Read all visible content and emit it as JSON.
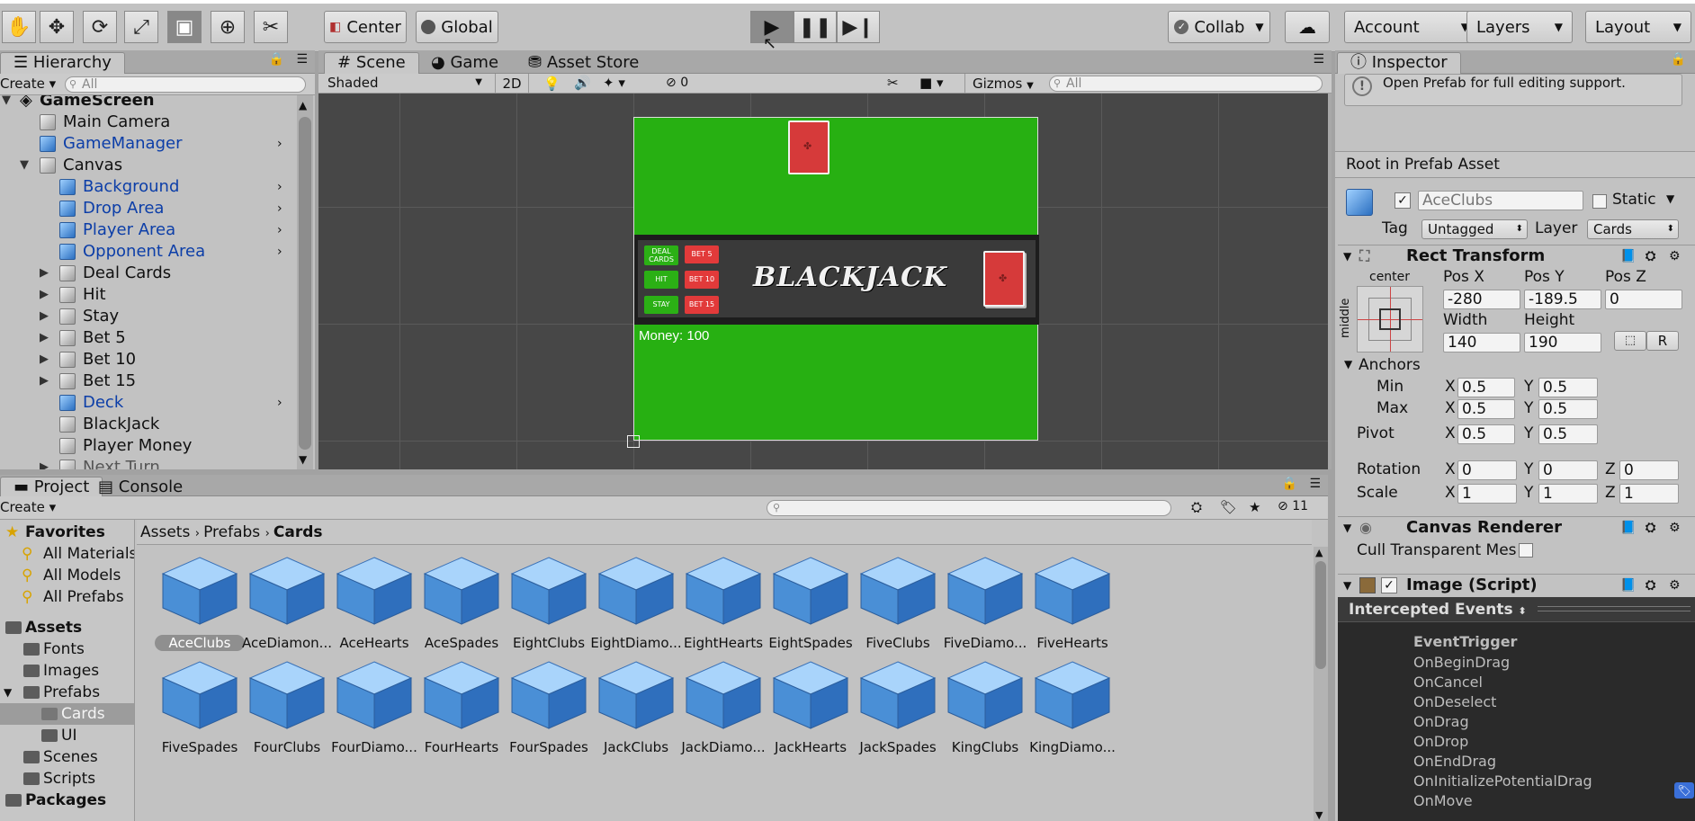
{
  "toolbar": {
    "pivot_label": "Center",
    "space_label": "Global",
    "collab_label": "Collab",
    "account_label": "Account",
    "layers_label": "Layers",
    "layout_label": "Layout"
  },
  "hierarchy": {
    "tab_label": "Hierarchy",
    "create_label": "Create",
    "search_placeholder": "All",
    "root_label": "GameScreen",
    "items": [
      {
        "label": "Main Camera"
      },
      {
        "label": "GameManager"
      },
      {
        "label": "Canvas"
      },
      {
        "label": "Background"
      },
      {
        "label": "Drop Area"
      },
      {
        "label": "Player Area"
      },
      {
        "label": "Opponent Area"
      },
      {
        "label": "Deal Cards"
      },
      {
        "label": "Hit"
      },
      {
        "label": "Stay"
      },
      {
        "label": "Bet 5"
      },
      {
        "label": "Bet 10"
      },
      {
        "label": "Bet 15"
      },
      {
        "label": "Deck"
      },
      {
        "label": "BlackJack"
      },
      {
        "label": "Player Money"
      },
      {
        "label": "Next Turn"
      }
    ]
  },
  "scene": {
    "tabs": [
      "Scene",
      "Game",
      "Asset Store"
    ],
    "shading_mode": "Shaded",
    "mode_2d": "2D",
    "hidden_count": "0",
    "gizmos_label": "Gizmos",
    "search_placeholder": "All",
    "game": {
      "deal_cards": "DEAL CARDS",
      "hit": "HIT",
      "stay": "STAY",
      "bet5": "BET 5",
      "bet10": "BET 10",
      "bet15": "BET 15",
      "title": "BLACKJACK",
      "money": "Money: 100"
    }
  },
  "project": {
    "tabs": [
      "Project",
      "Console"
    ],
    "create_label": "Create",
    "hidden_count": "11",
    "breadcrumb": [
      "Assets",
      "Prefabs",
      "Cards"
    ],
    "favorites_label": "Favorites",
    "favorites": [
      "All Materials",
      "All Models",
      "All Prefabs"
    ],
    "assets_label": "Assets",
    "folders": [
      "Fonts",
      "Images",
      "Prefabs",
      "Cards",
      "UI",
      "Scenes",
      "Scripts"
    ],
    "packages_label": "Packages",
    "grid_row1": [
      "AceClubs",
      "AceDiamon...",
      "AceHearts",
      "AceSpades",
      "EightClubs",
      "EightDiamo...",
      "EightHearts",
      "EightSpades",
      "FiveClubs",
      "FiveDiamo...",
      "FiveHearts"
    ],
    "grid_row2": [
      "FiveSpades",
      "FourClubs",
      "FourDiamo...",
      "FourHearts",
      "FourSpades",
      "JackClubs",
      "JackDiamo...",
      "JackHearts",
      "JackSpades",
      "KingClubs",
      "KingDiamo..."
    ]
  },
  "inspector": {
    "tab_label": "Inspector",
    "prefab_notice": "Open Prefab for full editing support.",
    "root_label": "Root in Prefab Asset",
    "object_name": "AceClubs",
    "static_label": "Static",
    "tag_label": "Tag",
    "tag_value": "Untagged",
    "layer_label": "Layer",
    "layer_value": "Cards",
    "rect_transform": {
      "title": "Rect Transform",
      "anchor_preset_h": "center",
      "anchor_preset_v": "middle",
      "pos_x_label": "Pos X",
      "pos_y_label": "Pos Y",
      "pos_z_label": "Pos Z",
      "pos_x": "-280",
      "pos_y": "-189.5",
      "pos_z": "0",
      "width_label": "Width",
      "height_label": "Height",
      "width": "140",
      "height": "190",
      "raw_button": "R",
      "anchors_label": "Anchors",
      "min_label": "Min",
      "max_label": "Max",
      "min_x": "0.5",
      "min_y": "0.5",
      "max_x": "0.5",
      "max_y": "0.5",
      "pivot_label": "Pivot",
      "pivot_x": "0.5",
      "pivot_y": "0.5",
      "rotation_label": "Rotation",
      "rot_x": "0",
      "rot_y": "0",
      "rot_z": "0",
      "scale_label": "Scale",
      "scale_x": "1",
      "scale_y": "1",
      "scale_z": "1",
      "x": "X",
      "y": "Y",
      "z": "Z"
    },
    "canvas_renderer": {
      "title": "Canvas Renderer",
      "cull_label": "Cull Transparent Mes"
    },
    "image_script": {
      "title": "Image (Script)"
    },
    "intercepted": {
      "title": "Intercepted Events",
      "header": "EventTrigger",
      "events": [
        "OnBeginDrag",
        "OnCancel",
        "OnDeselect",
        "OnDrag",
        "OnDrop",
        "OnEndDrag",
        "OnInitializePotentialDrag",
        "OnMove"
      ]
    }
  }
}
